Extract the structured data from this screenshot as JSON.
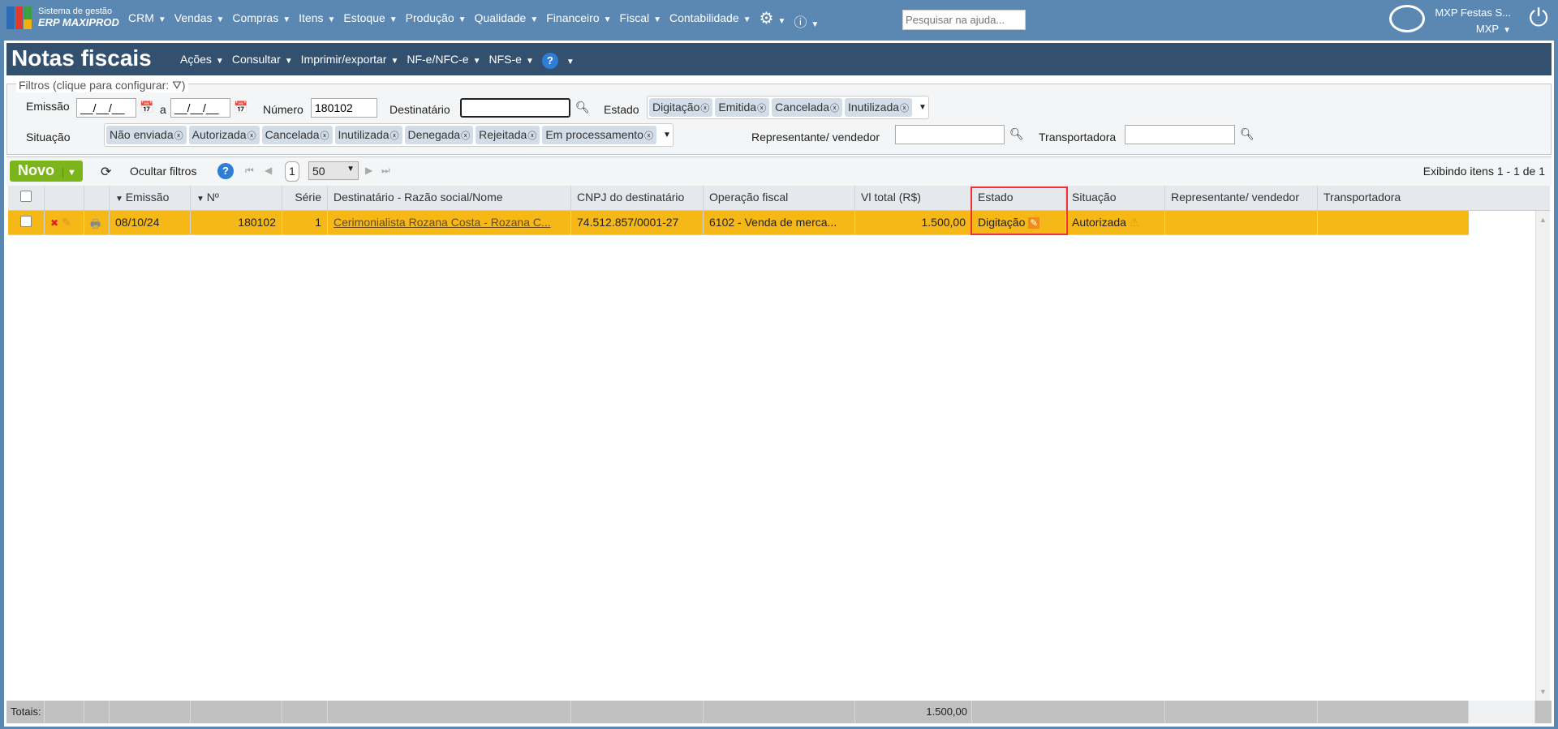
{
  "topbar": {
    "brand_line1": "Sistema de gestão",
    "brand_line2": "ERP MAXIPROD",
    "menu": [
      "CRM",
      "Vendas",
      "Compras",
      "Itens",
      "Estoque",
      "Produção",
      "Qualidade",
      "Financeiro",
      "Fiscal",
      "Contabilidade"
    ],
    "help_search_placeholder": "Pesquisar na ajuda...",
    "company": "MXP Festas S...",
    "user": "MXP"
  },
  "page": {
    "title": "Notas fiscais",
    "menu": [
      "Ações",
      "Consultar",
      "Imprimir/exportar",
      "NF-e/NFC-e",
      "NFS-e"
    ]
  },
  "filters": {
    "legend": "Filtros (clique para configurar:",
    "legend_end": ")",
    "emissao_label": "Emissão",
    "date_from": "__/__/__",
    "a_label": "a",
    "date_to": "__/__/__",
    "numero_label": "Número",
    "numero_value": "180102",
    "destinatario_label": "Destinatário",
    "destinatario_value": "",
    "estado_label": "Estado",
    "estado_tags": [
      "Digitação",
      "Emitida",
      "Cancelada",
      "Inutilizada"
    ],
    "situacao_label": "Situação",
    "situacao_tags": [
      "Não enviada",
      "Autorizada",
      "Cancelada",
      "Inutilizada",
      "Denegada",
      "Rejeitada",
      "Em processamento"
    ],
    "representante_label": "Representante/ vendedor",
    "representante_value": "",
    "transportadora_label": "Transportadora",
    "transportadora_value": ""
  },
  "toolbar": {
    "novo": "Novo",
    "ocultar": "Ocultar filtros",
    "page": "1",
    "page_size": "50",
    "showing": "Exibindo itens 1 - 1 de 1"
  },
  "table": {
    "headers": [
      "Emissão",
      "Nº",
      "Série",
      "Destinatário - Razão social/Nome",
      "CNPJ do destinatário",
      "Operação fiscal",
      "Vl total (R$)",
      "Estado",
      "Situação",
      "Representante/ vendedor",
      "Transportadora"
    ],
    "rows": [
      {
        "emissao": "08/10/24",
        "numero": "180102",
        "serie": "1",
        "destinatario": "Cerimonialista Rozana Costa - Rozana C...",
        "cnpj": "74.512.857/0001-27",
        "operacao": "6102 - Venda de merca...",
        "total": "1.500,00",
        "estado": "Digitação",
        "situacao": "Autorizada",
        "representante": "",
        "transportadora": ""
      }
    ],
    "totals_label": "Totais:",
    "totals_value": "1.500,00"
  },
  "colors": {
    "topbar": "#5b87b3",
    "titlebar": "#34506f",
    "row_selected": "#f5b816",
    "novo": "#7bb51b",
    "highlight": "#ee3333"
  }
}
